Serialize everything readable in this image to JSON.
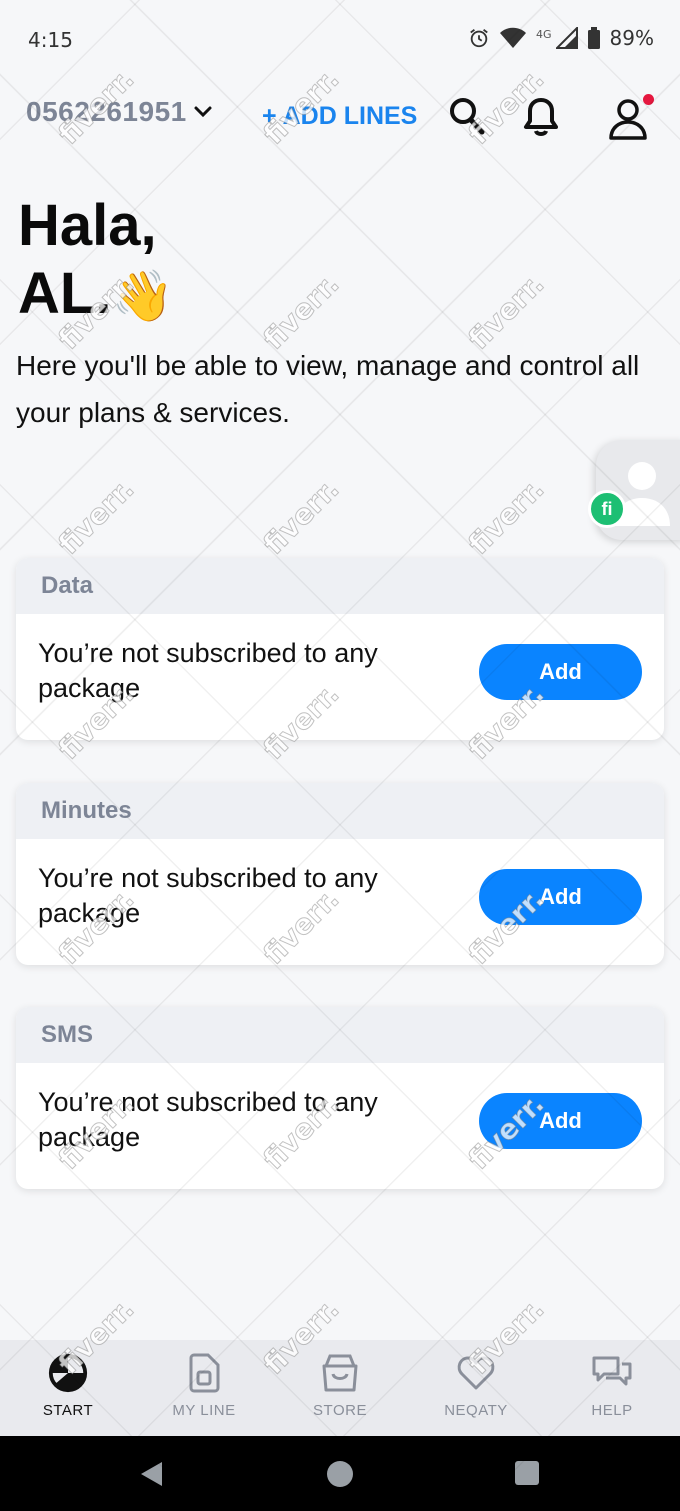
{
  "status_bar": {
    "time": "4:15",
    "network": "4G",
    "battery": "89%"
  },
  "header": {
    "phone_number": "0562261951",
    "add_lines": "+ ADD LINES"
  },
  "greeting": {
    "line1": "Hala,",
    "line2": "AL.",
    "emoji": "👋"
  },
  "intro": "Here you'll be able to view, manage and control all your plans & services.",
  "floating_badge": "fi",
  "cards": [
    {
      "title": "Data",
      "message": "You’re not subscribed to any package",
      "button": "Add"
    },
    {
      "title": "Minutes",
      "message": "You’re not subscribed to any package",
      "button": "Add"
    },
    {
      "title": "SMS",
      "message": "You’re not subscribed to any package",
      "button": "Add"
    }
  ],
  "nav": [
    {
      "label": "START",
      "icon": "start-icon",
      "active": true
    },
    {
      "label": "MY LINE",
      "icon": "sim-card-icon"
    },
    {
      "label": "STORE",
      "icon": "store-icon"
    },
    {
      "label": "NEQATY",
      "icon": "heart-icon"
    },
    {
      "label": "HELP",
      "icon": "chat-icon"
    }
  ],
  "watermark": "fiverr.",
  "colors": {
    "accent": "#0a84ff",
    "link": "#1a84ee",
    "muted": "#7d8596",
    "notification": "#e5173f",
    "fiverr_green": "#1dbf73"
  }
}
